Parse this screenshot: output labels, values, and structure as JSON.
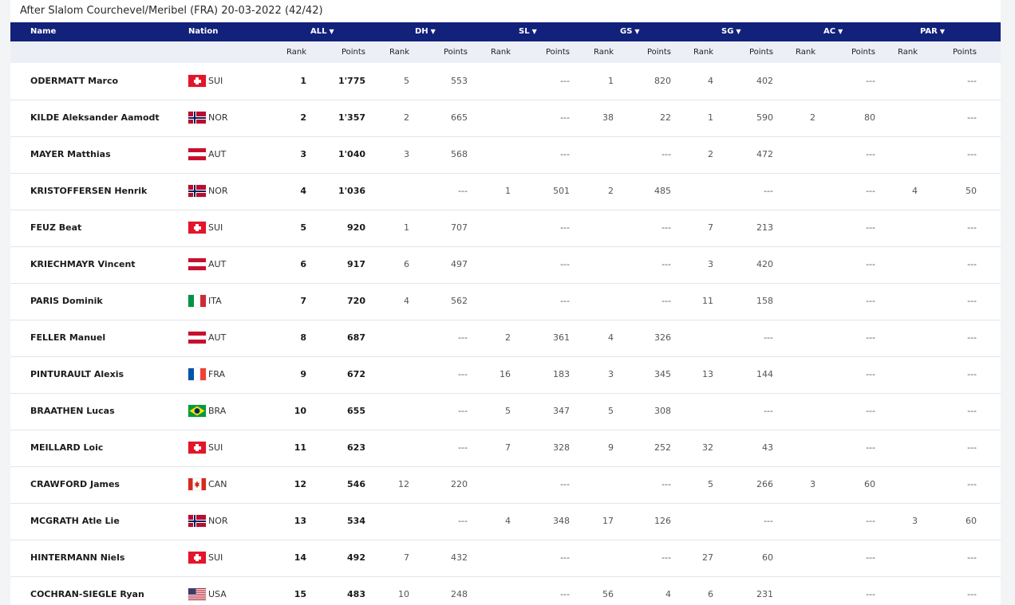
{
  "page": {
    "title": "After Slalom Courchevel/Meribel (FRA) 20-03-2022 (42/42)"
  },
  "header": {
    "name": "Name",
    "nation": "Nation",
    "disciplines": [
      "ALL",
      "DH",
      "SL",
      "GS",
      "SG",
      "AC",
      "PAR"
    ],
    "sort_icon": "triangle-down",
    "rank_label": "Rank",
    "points_label": "Points"
  },
  "colors": {
    "header_bg": "#12217a",
    "subheader_bg": "#eceff5",
    "row_border": "#e3e5ea"
  },
  "rows": [
    {
      "name": "ODERMATT Marco",
      "nation": "SUI",
      "all_rank": "1",
      "all_points": "1'775",
      "dh_rank": "5",
      "dh_points": "553",
      "sl_rank": "",
      "sl_points": "---",
      "gs_rank": "1",
      "gs_points": "820",
      "sg_rank": "4",
      "sg_points": "402",
      "ac_rank": "",
      "ac_points": "---",
      "par_rank": "",
      "par_points": "---"
    },
    {
      "name": "KILDE Aleksander Aamodt",
      "nation": "NOR",
      "all_rank": "2",
      "all_points": "1'357",
      "dh_rank": "2",
      "dh_points": "665",
      "sl_rank": "",
      "sl_points": "---",
      "gs_rank": "38",
      "gs_points": "22",
      "sg_rank": "1",
      "sg_points": "590",
      "ac_rank": "2",
      "ac_points": "80",
      "par_rank": "",
      "par_points": "---"
    },
    {
      "name": "MAYER Matthias",
      "nation": "AUT",
      "all_rank": "3",
      "all_points": "1'040",
      "dh_rank": "3",
      "dh_points": "568",
      "sl_rank": "",
      "sl_points": "---",
      "gs_rank": "",
      "gs_points": "---",
      "sg_rank": "2",
      "sg_points": "472",
      "ac_rank": "",
      "ac_points": "---",
      "par_rank": "",
      "par_points": "---"
    },
    {
      "name": "KRISTOFFERSEN Henrik",
      "nation": "NOR",
      "all_rank": "4",
      "all_points": "1'036",
      "dh_rank": "",
      "dh_points": "---",
      "sl_rank": "1",
      "sl_points": "501",
      "gs_rank": "2",
      "gs_points": "485",
      "sg_rank": "",
      "sg_points": "---",
      "ac_rank": "",
      "ac_points": "---",
      "par_rank": "4",
      "par_points": "50"
    },
    {
      "name": "FEUZ Beat",
      "nation": "SUI",
      "all_rank": "5",
      "all_points": "920",
      "dh_rank": "1",
      "dh_points": "707",
      "sl_rank": "",
      "sl_points": "---",
      "gs_rank": "",
      "gs_points": "---",
      "sg_rank": "7",
      "sg_points": "213",
      "ac_rank": "",
      "ac_points": "---",
      "par_rank": "",
      "par_points": "---"
    },
    {
      "name": "KRIECHMAYR Vincent",
      "nation": "AUT",
      "all_rank": "6",
      "all_points": "917",
      "dh_rank": "6",
      "dh_points": "497",
      "sl_rank": "",
      "sl_points": "---",
      "gs_rank": "",
      "gs_points": "---",
      "sg_rank": "3",
      "sg_points": "420",
      "ac_rank": "",
      "ac_points": "---",
      "par_rank": "",
      "par_points": "---"
    },
    {
      "name": "PARIS Dominik",
      "nation": "ITA",
      "all_rank": "7",
      "all_points": "720",
      "dh_rank": "4",
      "dh_points": "562",
      "sl_rank": "",
      "sl_points": "---",
      "gs_rank": "",
      "gs_points": "---",
      "sg_rank": "11",
      "sg_points": "158",
      "ac_rank": "",
      "ac_points": "---",
      "par_rank": "",
      "par_points": "---"
    },
    {
      "name": "FELLER Manuel",
      "nation": "AUT",
      "all_rank": "8",
      "all_points": "687",
      "dh_rank": "",
      "dh_points": "---",
      "sl_rank": "2",
      "sl_points": "361",
      "gs_rank": "4",
      "gs_points": "326",
      "sg_rank": "",
      "sg_points": "---",
      "ac_rank": "",
      "ac_points": "---",
      "par_rank": "",
      "par_points": "---"
    },
    {
      "name": "PINTURAULT Alexis",
      "nation": "FRA",
      "all_rank": "9",
      "all_points": "672",
      "dh_rank": "",
      "dh_points": "---",
      "sl_rank": "16",
      "sl_points": "183",
      "gs_rank": "3",
      "gs_points": "345",
      "sg_rank": "13",
      "sg_points": "144",
      "ac_rank": "",
      "ac_points": "---",
      "par_rank": "",
      "par_points": "---"
    },
    {
      "name": "BRAATHEN Lucas",
      "nation": "BRA",
      "all_rank": "10",
      "all_points": "655",
      "dh_rank": "",
      "dh_points": "---",
      "sl_rank": "5",
      "sl_points": "347",
      "gs_rank": "5",
      "gs_points": "308",
      "sg_rank": "",
      "sg_points": "---",
      "ac_rank": "",
      "ac_points": "---",
      "par_rank": "",
      "par_points": "---"
    },
    {
      "name": "MEILLARD Loic",
      "nation": "SUI",
      "all_rank": "11",
      "all_points": "623",
      "dh_rank": "",
      "dh_points": "---",
      "sl_rank": "7",
      "sl_points": "328",
      "gs_rank": "9",
      "gs_points": "252",
      "sg_rank": "32",
      "sg_points": "43",
      "ac_rank": "",
      "ac_points": "---",
      "par_rank": "",
      "par_points": "---"
    },
    {
      "name": "CRAWFORD James",
      "nation": "CAN",
      "all_rank": "12",
      "all_points": "546",
      "dh_rank": "12",
      "dh_points": "220",
      "sl_rank": "",
      "sl_points": "---",
      "gs_rank": "",
      "gs_points": "---",
      "sg_rank": "5",
      "sg_points": "266",
      "ac_rank": "3",
      "ac_points": "60",
      "par_rank": "",
      "par_points": "---"
    },
    {
      "name": "MCGRATH Atle Lie",
      "nation": "NOR",
      "all_rank": "13",
      "all_points": "534",
      "dh_rank": "",
      "dh_points": "---",
      "sl_rank": "4",
      "sl_points": "348",
      "gs_rank": "17",
      "gs_points": "126",
      "sg_rank": "",
      "sg_points": "---",
      "ac_rank": "",
      "ac_points": "---",
      "par_rank": "3",
      "par_points": "60"
    },
    {
      "name": "HINTERMANN Niels",
      "nation": "SUI",
      "all_rank": "14",
      "all_points": "492",
      "dh_rank": "7",
      "dh_points": "432",
      "sl_rank": "",
      "sl_points": "---",
      "gs_rank": "",
      "gs_points": "---",
      "sg_rank": "27",
      "sg_points": "60",
      "ac_rank": "",
      "ac_points": "---",
      "par_rank": "",
      "par_points": "---"
    },
    {
      "name": "COCHRAN-SIEGLE Ryan",
      "nation": "USA",
      "all_rank": "15",
      "all_points": "483",
      "dh_rank": "10",
      "dh_points": "248",
      "sl_rank": "",
      "sl_points": "---",
      "gs_rank": "56",
      "gs_points": "4",
      "sg_rank": "6",
      "sg_points": "231",
      "ac_rank": "",
      "ac_points": "---",
      "par_rank": "",
      "par_points": "---"
    }
  ]
}
